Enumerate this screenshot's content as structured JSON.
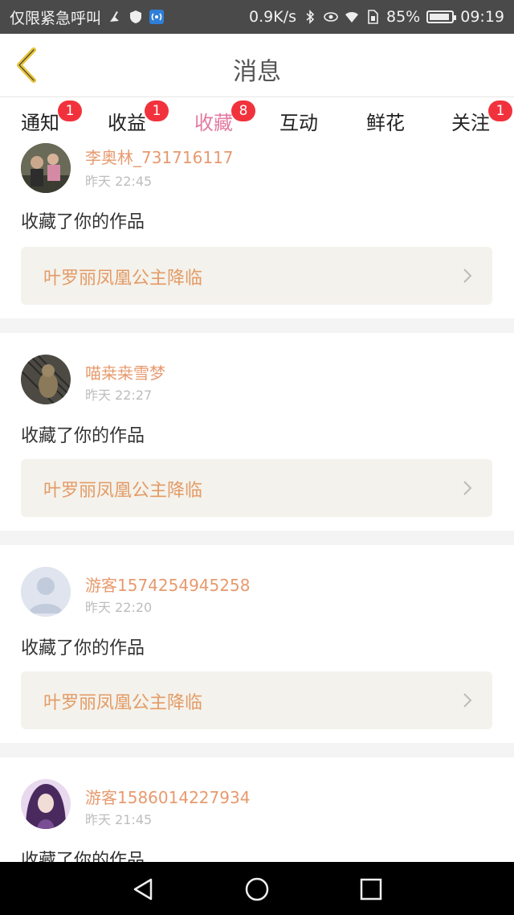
{
  "status_bar": {
    "left_text": "仅限紧急呼叫",
    "speed": "0.9K/s",
    "battery_pct": "85%",
    "time": "09:19"
  },
  "header": {
    "title": "消息"
  },
  "tabs": [
    {
      "label": "通知",
      "badge": "1"
    },
    {
      "label": "收益",
      "badge": "1"
    },
    {
      "label": "收藏",
      "badge": "8"
    },
    {
      "label": "互动",
      "badge": ""
    },
    {
      "label": "鲜花",
      "badge": ""
    },
    {
      "label": "关注",
      "badge": "1"
    }
  ],
  "active_tab": "收藏",
  "items": [
    {
      "user": "李奥林_731716117",
      "time": "昨天 22:45",
      "action": "收藏了你的作品",
      "work": "叶罗丽凤凰公主降临"
    },
    {
      "user": "喵桒桒雪梦",
      "time": "昨天 22:27",
      "action": "收藏了你的作品",
      "work": "叶罗丽凤凰公主降临"
    },
    {
      "user": "游客1574254945258",
      "time": "昨天 22:20",
      "action": "收藏了你的作品",
      "work": "叶罗丽凤凰公主降临"
    },
    {
      "user": "游客1586014227934",
      "time": "昨天 21:45",
      "action": "收藏了你的作品",
      "work": ""
    }
  ],
  "colors": {
    "accent_pink": "#e27aa0",
    "username_orange": "#e79a6e",
    "badge_red": "#f1323c",
    "back_icon": "#e8c33a"
  }
}
